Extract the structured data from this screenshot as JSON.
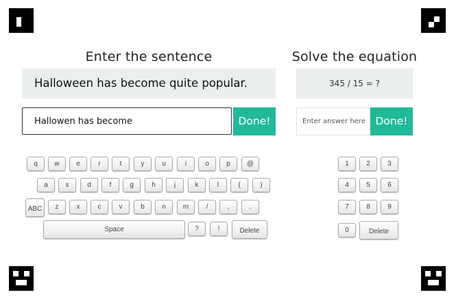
{
  "sentence_task": {
    "heading": "Enter the sentence",
    "target": "Halloween has become quite popular.",
    "typed": "Hallowen has become",
    "done_label": "Done!"
  },
  "equation_task": {
    "heading": "Solve the equation",
    "equation": "345 / 15 = ?",
    "answer_placeholder": "Enter answer here",
    "done_label": "Done!"
  },
  "keyboard": {
    "row1": [
      "q",
      "w",
      "e",
      "r",
      "t",
      "y",
      "u",
      "i",
      "o",
      "p",
      "@"
    ],
    "row2": [
      "a",
      "s",
      "d",
      "f",
      "g",
      "h",
      "j",
      "k",
      "l",
      "(",
      ")"
    ],
    "row3": [
      "ABC",
      "z",
      "x",
      "c",
      "v",
      "b",
      "n",
      "m",
      "/",
      ",",
      "."
    ],
    "row4": [
      "Space",
      "?",
      "!",
      "Delete"
    ]
  },
  "numpad": {
    "row1": [
      "1",
      "2",
      "3"
    ],
    "row2": [
      "4",
      "5",
      "6"
    ],
    "row3": [
      "7",
      "8",
      "9"
    ],
    "row4": [
      "0",
      "Delete"
    ]
  }
}
